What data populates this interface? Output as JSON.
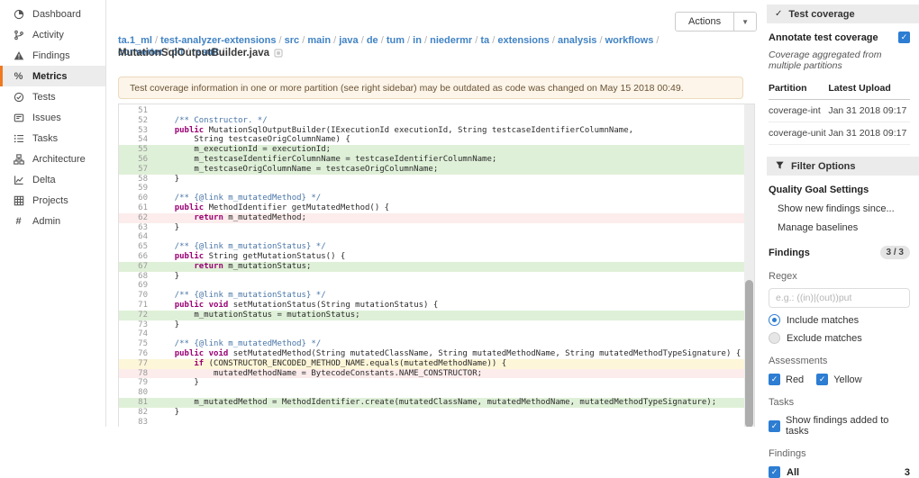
{
  "colors": {
    "accent_orange": "#f0781e",
    "link_blue": "#4183c4",
    "checkbox_blue": "#2d7dd2",
    "covered_green": "#dff0d8",
    "uncovered_red": "#fcecec",
    "partial_yellow": "#fdf6d8"
  },
  "sidebar": {
    "items": [
      {
        "label": "Dashboard",
        "icon": "dashboard-icon",
        "active": false
      },
      {
        "label": "Activity",
        "icon": "activity-icon",
        "active": false
      },
      {
        "label": "Findings",
        "icon": "findings-icon",
        "active": false
      },
      {
        "label": "Metrics",
        "icon": "metrics-icon",
        "active": true
      },
      {
        "label": "Tests",
        "icon": "tests-icon",
        "active": false
      },
      {
        "label": "Issues",
        "icon": "issues-icon",
        "active": false
      },
      {
        "label": "Tasks",
        "icon": "tasks-icon",
        "active": false
      },
      {
        "label": "Architecture",
        "icon": "architecture-icon",
        "active": false
      },
      {
        "label": "Delta",
        "icon": "delta-icon",
        "active": false
      },
      {
        "label": "Projects",
        "icon": "projects-icon",
        "active": false
      },
      {
        "label": "Admin",
        "icon": "admin-icon",
        "active": false
      }
    ]
  },
  "header": {
    "actions_label": "Actions",
    "breadcrumb": [
      "ta.1_ml",
      "test-analyzer-extensions",
      "src",
      "main",
      "java",
      "de",
      "tum",
      "in",
      "niedermr",
      "ta",
      "extensions",
      "analysis",
      "workflows",
      "converter",
      "pit",
      "result"
    ],
    "filename": "MutationSqlOutputBuilder.java"
  },
  "warning": {
    "text": "Test coverage information in one or more partition (see right sidebar) may be outdated as code was changed on May 15 2018 00:49."
  },
  "code": {
    "lines": [
      {
        "n": 51,
        "parts": []
      },
      {
        "n": 52,
        "parts": [
          {
            "c": "c",
            "t": "    /** Constructor. */"
          }
        ]
      },
      {
        "n": 53,
        "parts": [
          {
            "t": "    "
          },
          {
            "c": "k",
            "t": "public"
          },
          {
            "t": " MutationSqlOutputBuilder(IExecutionId executionId, String testcaseIdentifierColumnName,"
          }
        ]
      },
      {
        "n": 54,
        "parts": [
          {
            "t": "        String testcaseOrigColumnName) {"
          }
        ]
      },
      {
        "n": 55,
        "cov": "g",
        "parts": [
          {
            "t": "        m_executionId = executionId;"
          }
        ]
      },
      {
        "n": 56,
        "cov": "g",
        "parts": [
          {
            "t": "        m_testcaseIdentifierColumnName = testcaseIdentifierColumnName;"
          }
        ]
      },
      {
        "n": 57,
        "cov": "g",
        "parts": [
          {
            "t": "        m_testcaseOrigColumnName = testcaseOrigColumnName;"
          }
        ]
      },
      {
        "n": 58,
        "parts": [
          {
            "t": "    }"
          }
        ]
      },
      {
        "n": 59,
        "parts": []
      },
      {
        "n": 60,
        "parts": [
          {
            "c": "c",
            "t": "    /** {@link m_mutatedMethod} */"
          }
        ]
      },
      {
        "n": 61,
        "parts": [
          {
            "t": "    "
          },
          {
            "c": "k",
            "t": "public"
          },
          {
            "t": " MethodIdentifier getMutatedMethod() {"
          }
        ]
      },
      {
        "n": 62,
        "cov": "r",
        "parts": [
          {
            "t": "        "
          },
          {
            "c": "k",
            "t": "return"
          },
          {
            "t": " m_mutatedMethod;"
          }
        ]
      },
      {
        "n": 63,
        "parts": [
          {
            "t": "    }"
          }
        ]
      },
      {
        "n": 64,
        "parts": []
      },
      {
        "n": 65,
        "parts": [
          {
            "c": "c",
            "t": "    /** {@link m_mutationStatus} */"
          }
        ]
      },
      {
        "n": 66,
        "parts": [
          {
            "t": "    "
          },
          {
            "c": "k",
            "t": "public"
          },
          {
            "t": " String getMutationStatus() {"
          }
        ]
      },
      {
        "n": 67,
        "cov": "g",
        "parts": [
          {
            "t": "        "
          },
          {
            "c": "k",
            "t": "return"
          },
          {
            "t": " m_mutationStatus;"
          }
        ]
      },
      {
        "n": 68,
        "parts": [
          {
            "t": "    }"
          }
        ]
      },
      {
        "n": 69,
        "parts": []
      },
      {
        "n": 70,
        "parts": [
          {
            "c": "c",
            "t": "    /** {@link m_mutationStatus} */"
          }
        ]
      },
      {
        "n": 71,
        "parts": [
          {
            "t": "    "
          },
          {
            "c": "k",
            "t": "public void"
          },
          {
            "t": " setMutationStatus(String mutationStatus) {"
          }
        ]
      },
      {
        "n": 72,
        "cov": "g",
        "parts": [
          {
            "t": "        m_mutationStatus = mutationStatus;"
          }
        ]
      },
      {
        "n": 73,
        "parts": [
          {
            "t": "    }"
          }
        ]
      },
      {
        "n": 74,
        "parts": []
      },
      {
        "n": 75,
        "parts": [
          {
            "c": "c",
            "t": "    /** {@link m_mutatedMethod} */"
          }
        ]
      },
      {
        "n": 76,
        "parts": [
          {
            "t": "    "
          },
          {
            "c": "k",
            "t": "public void"
          },
          {
            "t": " setMutatedMethod(String mutatedClassName, String mutatedMethodName, String mutatedMethodTypeSignature) {"
          }
        ]
      },
      {
        "n": 77,
        "cov": "y",
        "parts": [
          {
            "t": "        "
          },
          {
            "c": "k",
            "t": "if"
          },
          {
            "t": " (CONSTRUCTOR_ENCODED_METHOD_NAME.equals(mutatedMethodName)) {"
          }
        ]
      },
      {
        "n": 78,
        "cov": "r",
        "parts": [
          {
            "t": "            mutatedMethodName = BytecodeConstants.NAME_CONSTRUCTOR;"
          }
        ]
      },
      {
        "n": 79,
        "parts": [
          {
            "t": "        }"
          }
        ]
      },
      {
        "n": 80,
        "parts": []
      },
      {
        "n": 81,
        "cov": "g",
        "parts": [
          {
            "t": "        m_mutatedMethod = MethodIdentifier.create(mutatedClassName, mutatedMethodName, mutatedMethodTypeSignature);"
          }
        ]
      },
      {
        "n": 82,
        "parts": [
          {
            "t": "    }"
          }
        ]
      },
      {
        "n": 83,
        "parts": []
      }
    ]
  },
  "right_panel": {
    "test_coverage": {
      "title": "Test coverage",
      "annotate_label": "Annotate test coverage",
      "annotate_checked": true,
      "note": "Coverage aggregated from multiple partitions",
      "table": {
        "headers": [
          "Partition",
          "Latest Upload"
        ],
        "rows": [
          [
            "coverage-int",
            "Jan 31 2018 09:17"
          ],
          [
            "coverage-unit",
            "Jan 31 2018 09:17"
          ]
        ]
      }
    },
    "filter_options": {
      "title": "Filter Options",
      "quality_goal": {
        "heading": "Quality Goal Settings",
        "link1": "Show new findings since...",
        "link2": "Manage baselines"
      },
      "findings_summary": {
        "heading": "Findings",
        "badge": "3 / 3"
      },
      "regex": {
        "label": "Regex",
        "placeholder": "e.g.: ((in)|(out))put",
        "include_label": "Include matches",
        "exclude_label": "Exclude matches",
        "include_selected": true,
        "exclude_selected": false
      },
      "assessments": {
        "label": "Assessments",
        "options": [
          {
            "label": "Red",
            "checked": true
          },
          {
            "label": "Yellow",
            "checked": true
          }
        ]
      },
      "tasks": {
        "label": "Tasks",
        "option_label": "Show findings added to tasks",
        "checked": true
      },
      "findings_filter": {
        "label": "Findings",
        "all_label": "All",
        "all_checked": true,
        "count": "3"
      }
    }
  }
}
